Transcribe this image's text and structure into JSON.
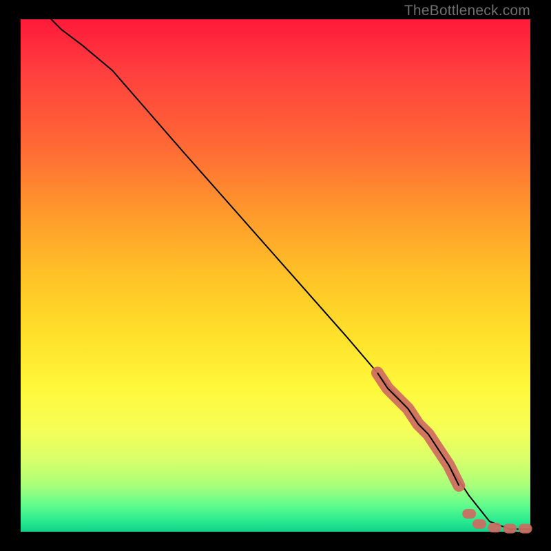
{
  "watermark": "TheBottleneck.com",
  "chart_data": {
    "type": "line",
    "title": "",
    "xlabel": "",
    "ylabel": "",
    "xlim": [
      0,
      100
    ],
    "ylim": [
      0,
      100
    ],
    "grid": false,
    "legend": false,
    "annotations": [],
    "series": [
      {
        "name": "curve",
        "style": "line",
        "color": "#000000",
        "x": [
          6,
          8,
          12,
          18,
          25,
          32,
          40,
          48,
          56,
          64,
          70,
          76,
          80,
          84,
          88,
          92,
          96,
          100
        ],
        "y": [
          100,
          98,
          95,
          90,
          82,
          74,
          65,
          56,
          47,
          38,
          31,
          24,
          19,
          13,
          7,
          2,
          0.5,
          0.5
        ]
      },
      {
        "name": "highlight-upper",
        "style": "thick-segment",
        "color": "#cf6a61",
        "x": [
          70,
          72,
          74,
          76,
          78,
          80,
          82,
          84,
          86
        ],
        "y": [
          31,
          28,
          26,
          24,
          21,
          19,
          16,
          13,
          9
        ]
      },
      {
        "name": "highlight-lower-dashes",
        "style": "dash-points",
        "color": "#cf6a61",
        "points": [
          {
            "x": 88,
            "y": 3.5
          },
          {
            "x": 90,
            "y": 1.5
          },
          {
            "x": 93,
            "y": 0.8
          },
          {
            "x": 96,
            "y": 0.6
          },
          {
            "x": 99,
            "y": 0.6
          }
        ]
      }
    ]
  },
  "colors": {
    "marker": "#cf6a61",
    "curve": "#000000",
    "background_top": "#ff1a3a",
    "background_bottom": "#11d18a"
  }
}
